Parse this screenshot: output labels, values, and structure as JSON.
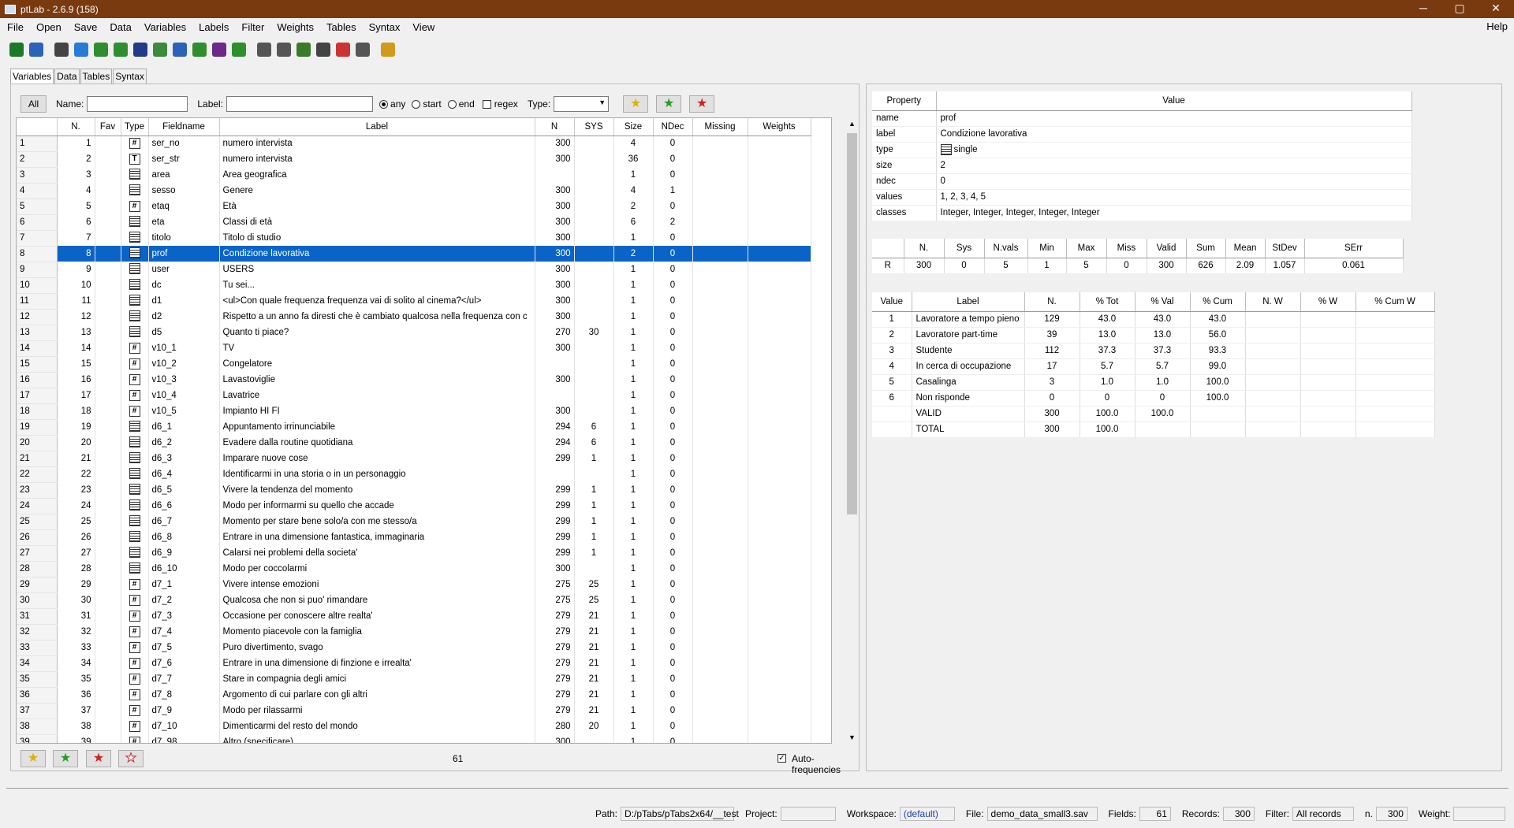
{
  "window": {
    "title": "ptLab - 2.6.9 (158)",
    "minimize": "─",
    "maximize": "▢",
    "close": "✕"
  },
  "menu": [
    "File",
    "Open",
    "Save",
    "Data",
    "Variables",
    "Labels",
    "Filter",
    "Weights",
    "Tables",
    "Syntax",
    "View"
  ],
  "menu_help": "Help",
  "toolbar_icons": [
    {
      "name": "export-icon",
      "color": "#1b7a2a"
    },
    {
      "name": "grid-icon",
      "color": "#2a63b8"
    },
    {
      "name": "layout-icon",
      "color": "#444"
    },
    {
      "name": "refresh-icon",
      "color": "#2a7ad8"
    },
    {
      "name": "spss-icon",
      "color": "#2f8f2f"
    },
    {
      "name": "excel-icon",
      "color": "#2f8f2f"
    },
    {
      "name": "sas-icon",
      "color": "#223a8a"
    },
    {
      "name": "sss-icon",
      "color": "#3c8a3c"
    },
    {
      "name": "s-icon",
      "color": "#2a63b8"
    },
    {
      "name": "r-icon",
      "color": "#2f8f2f"
    },
    {
      "name": "database-icon",
      "color": "#6b2a8a"
    },
    {
      "name": "report-icon",
      "color": "#2f8f2f"
    },
    {
      "name": "balance-icon",
      "color": "#555"
    },
    {
      "name": "balance2-icon",
      "color": "#555"
    },
    {
      "name": "filter-icon",
      "color": "#3a7a2a"
    },
    {
      "name": "filter-clear-icon",
      "color": "#444"
    },
    {
      "name": "sort-icon",
      "color": "#c33"
    },
    {
      "name": "recode-icon",
      "color": "#555"
    },
    {
      "name": "key-icon",
      "color": "#d19a1a"
    }
  ],
  "tabs": [
    "Variables",
    "Data",
    "Tables",
    "Syntax"
  ],
  "filter": {
    "all_label": "All",
    "name_label": "Name:",
    "name_value": "",
    "label_label": "Label:",
    "label_value": "",
    "any": "any",
    "start": "start",
    "end": "end",
    "regex": "regex",
    "type_label": "Type:",
    "type_value": ""
  },
  "star_colors": [
    "#e0b000",
    "#20a020",
    "#d02020"
  ],
  "var_columns": [
    "",
    "N.",
    "Fav",
    "Type",
    "Fieldname",
    "Label",
    "N",
    "SYS",
    "Size",
    "NDec",
    "Missing",
    "Weights"
  ],
  "variables": [
    [
      "1",
      "1",
      "",
      "#",
      "ser_no",
      "numero intervista",
      "300",
      "",
      "4",
      "0"
    ],
    [
      "2",
      "2",
      "",
      "T",
      "ser_str",
      "numero intervista",
      "300",
      "",
      "36",
      "0"
    ],
    [
      "3",
      "3",
      "",
      "L",
      "area",
      "Area geografica",
      "",
      "",
      "1",
      "0"
    ],
    [
      "4",
      "4",
      "",
      "L",
      "sesso",
      "Genere",
      "300",
      "",
      "4",
      "1"
    ],
    [
      "5",
      "5",
      "",
      "#",
      "etaq",
      "Età",
      "300",
      "",
      "2",
      "0"
    ],
    [
      "6",
      "6",
      "",
      "L",
      "eta",
      "Classi di età",
      "300",
      "",
      "6",
      "2"
    ],
    [
      "7",
      "7",
      "",
      "L",
      "titolo",
      "Titolo di studio",
      "300",
      "",
      "1",
      "0"
    ],
    [
      "8",
      "8",
      "",
      "L",
      "prof",
      "Condizione lavorativa",
      "300",
      "",
      "2",
      "0"
    ],
    [
      "9",
      "9",
      "",
      "L",
      "user",
      "USERS",
      "300",
      "",
      "1",
      "0"
    ],
    [
      "10",
      "10",
      "",
      "L",
      "dc",
      "Tu sei...",
      "300",
      "",
      "1",
      "0"
    ],
    [
      "11",
      "11",
      "",
      "L",
      "d1",
      "<ul>Con quale frequenza frequenza vai di solito al cinema?</ul>",
      "300",
      "",
      "1",
      "0"
    ],
    [
      "12",
      "12",
      "",
      "L",
      "d2",
      "Rispetto a un anno fa diresti che è cambiato qualcosa nella frequenza con c",
      "300",
      "",
      "1",
      "0"
    ],
    [
      "13",
      "13",
      "",
      "L",
      "d5",
      "Quanto ti piace?",
      "270",
      "30",
      "1",
      "0"
    ],
    [
      "14",
      "14",
      "",
      "#",
      "v10_1",
      "TV",
      "300",
      "",
      "1",
      "0"
    ],
    [
      "15",
      "15",
      "",
      "#",
      "v10_2",
      "Congelatore",
      "",
      "",
      "1",
      "0"
    ],
    [
      "16",
      "16",
      "",
      "#",
      "v10_3",
      "Lavastoviglie",
      "300",
      "",
      "1",
      "0"
    ],
    [
      "17",
      "17",
      "",
      "#",
      "v10_4",
      "Lavatrice",
      "",
      "",
      "1",
      "0"
    ],
    [
      "18",
      "18",
      "",
      "#",
      "v10_5",
      "Impianto HI FI",
      "300",
      "",
      "1",
      "0"
    ],
    [
      "19",
      "19",
      "",
      "L",
      "d6_1",
      "Appuntamento irrinunciabile",
      "294",
      "6",
      "1",
      "0"
    ],
    [
      "20",
      "20",
      "",
      "L",
      "d6_2",
      "Evadere dalla routine quotidiana",
      "294",
      "6",
      "1",
      "0"
    ],
    [
      "21",
      "21",
      "",
      "L",
      "d6_3",
      "Imparare nuove cose",
      "299",
      "1",
      "1",
      "0"
    ],
    [
      "22",
      "22",
      "",
      "L",
      "d6_4",
      "Identificarmi in una storia o in un personaggio",
      "",
      "",
      "1",
      "0"
    ],
    [
      "23",
      "23",
      "",
      "L",
      "d6_5",
      "Vivere la tendenza del momento",
      "299",
      "1",
      "1",
      "0"
    ],
    [
      "24",
      "24",
      "",
      "L",
      "d6_6",
      "Modo per informarmi su quello che accade",
      "299",
      "1",
      "1",
      "0"
    ],
    [
      "25",
      "25",
      "",
      "L",
      "d6_7",
      "Momento per stare bene solo/a con me stesso/a",
      "299",
      "1",
      "1",
      "0"
    ],
    [
      "26",
      "26",
      "",
      "L",
      "d6_8",
      "Entrare in una dimensione fantastica, immaginaria",
      "299",
      "1",
      "1",
      "0"
    ],
    [
      "27",
      "27",
      "",
      "L",
      "d6_9",
      "Calarsi nei problemi della societa'",
      "299",
      "1",
      "1",
      "0"
    ],
    [
      "28",
      "28",
      "",
      "L",
      "d6_10",
      "Modo per coccolarmi",
      "300",
      "",
      "1",
      "0"
    ],
    [
      "29",
      "29",
      "",
      "#",
      "d7_1",
      "Vivere intense emozioni",
      "275",
      "25",
      "1",
      "0"
    ],
    [
      "30",
      "30",
      "",
      "#",
      "d7_2",
      "Qualcosa che non si puo' rimandare",
      "275",
      "25",
      "1",
      "0"
    ],
    [
      "31",
      "31",
      "",
      "#",
      "d7_3",
      "Occasione per conoscere altre realta'",
      "279",
      "21",
      "1",
      "0"
    ],
    [
      "32",
      "32",
      "",
      "#",
      "d7_4",
      "Momento piacevole con la famiglia",
      "279",
      "21",
      "1",
      "0"
    ],
    [
      "33",
      "33",
      "",
      "#",
      "d7_5",
      "Puro divertimento, svago",
      "279",
      "21",
      "1",
      "0"
    ],
    [
      "34",
      "34",
      "",
      "#",
      "d7_6",
      "Entrare in una dimensione di finzione e irrealta'",
      "279",
      "21",
      "1",
      "0"
    ],
    [
      "35",
      "35",
      "",
      "#",
      "d7_7",
      "Stare in compagnia degli amici",
      "279",
      "21",
      "1",
      "0"
    ],
    [
      "36",
      "36",
      "",
      "#",
      "d7_8",
      "Argomento di cui parlare con gli altri",
      "279",
      "21",
      "1",
      "0"
    ],
    [
      "37",
      "37",
      "",
      "#",
      "d7_9",
      "Modo per rilassarmi",
      "279",
      "21",
      "1",
      "0"
    ],
    [
      "38",
      "38",
      "",
      "#",
      "d7_10",
      "Dimenticarmi del resto del mondo",
      "280",
      "20",
      "1",
      "0"
    ],
    [
      "39",
      "39",
      "",
      "#",
      "d7_98",
      "Altro (specificare)",
      "300",
      "",
      "1",
      "0"
    ]
  ],
  "selected_row": 7,
  "var_count": "61",
  "auto_frequencies": "Auto-frequencies",
  "props": {
    "headers": [
      "Property",
      "Value"
    ],
    "rows": [
      [
        "name",
        "prof"
      ],
      [
        "label",
        "Condizione lavorativa"
      ],
      [
        "type",
        "single"
      ],
      [
        "size",
        "2"
      ],
      [
        "ndec",
        "0"
      ],
      [
        "values",
        "1, 2, 3, 4, 5"
      ],
      [
        "classes",
        "Integer, Integer, Integer, Integer, Integer"
      ]
    ]
  },
  "stats": {
    "headers": [
      "",
      "N.",
      "Sys",
      "N.vals",
      "Min",
      "Max",
      "Miss",
      "Valid",
      "Sum",
      "Mean",
      "StDev",
      "SErr"
    ],
    "row": [
      "R",
      "300",
      "0",
      "5",
      "1",
      "5",
      "0",
      "300",
      "626",
      "2.09",
      "1.057",
      "0.061"
    ]
  },
  "freq": {
    "headers": [
      "Value",
      "Label",
      "N.",
      "% Tot",
      "% Val",
      "% Cum",
      "N. W",
      "% W",
      "% Cum W"
    ],
    "rows": [
      [
        "1",
        "Lavoratore a tempo pieno",
        "129",
        "43.0",
        "43.0",
        "43.0"
      ],
      [
        "2",
        "Lavoratore part-time",
        "39",
        "13.0",
        "13.0",
        "56.0"
      ],
      [
        "3",
        "Studente",
        "112",
        "37.3",
        "37.3",
        "93.3"
      ],
      [
        "4",
        "In cerca di occupazione",
        "17",
        "5.7",
        "5.7",
        "99.0"
      ],
      [
        "5",
        "Casalinga",
        "3",
        "1.0",
        "1.0",
        "100.0"
      ],
      [
        "6",
        "Non risponde",
        "0",
        "0",
        "0",
        "100.0"
      ],
      [
        "",
        "VALID",
        "300",
        "100.0",
        "100.0",
        ""
      ],
      [
        "",
        "TOTAL",
        "300",
        "100.0",
        "",
        ""
      ]
    ]
  },
  "status": {
    "path_label": "Path:",
    "path": "D:/pTabs/pTabs2x64/__test",
    "project_label": "Project:",
    "project": "",
    "workspace_label": "Workspace:",
    "workspace": "(default)",
    "file_label": "File:",
    "file": "demo_data_small3.sav",
    "fields_label": "Fields:",
    "fields": "61",
    "records_label": "Records:",
    "records": "300",
    "filter_label": "Filter:",
    "filter": "All records",
    "n_label": "n.",
    "n": "300",
    "weight_label": "Weight:",
    "weight": ""
  }
}
